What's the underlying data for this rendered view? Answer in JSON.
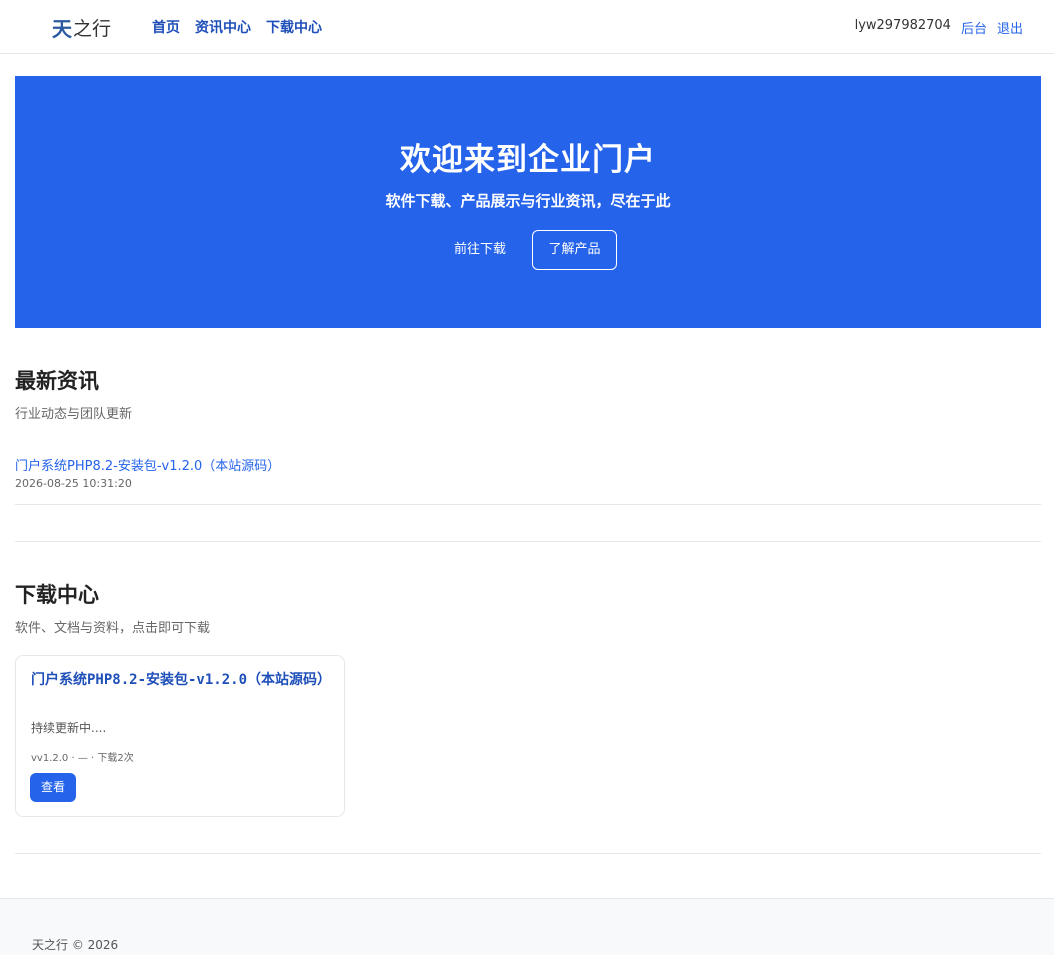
{
  "header": {
    "logo_mark": "天",
    "logo_text": "之行",
    "nav": [
      "首页",
      "资讯中心",
      "下载中心"
    ],
    "username": "lyw297982704",
    "admin_link": "后台",
    "logout_link": "退出"
  },
  "hero": {
    "title": "欢迎来到企业门户",
    "subtitle": "软件下载、产品展示与行业资讯，尽在于此",
    "download_button": "前往下载",
    "product_button": "了解产品"
  },
  "news": {
    "title": "最新资讯",
    "subtitle": "行业动态与团队更新",
    "items": [
      {
        "title": "门户系统PHP8.2-安装包-v1.2.0（本站源码）",
        "date": "2026-08-25 10:31:20"
      }
    ]
  },
  "downloads": {
    "title": "下载中心",
    "subtitle": "软件、文档与资料，点击即可下载",
    "items": [
      {
        "title": "门户系统PHP8.2-安装包-v1.2.0（本站源码）",
        "desc": "持续更新中....",
        "meta": "vv1.2.0 · — · 下载2次",
        "button": "查看"
      }
    ]
  },
  "footer": {
    "text": "天之行 © 2026"
  },
  "colors": {
    "accent": "#2563eb",
    "nav_link": "#1f4fb8"
  }
}
